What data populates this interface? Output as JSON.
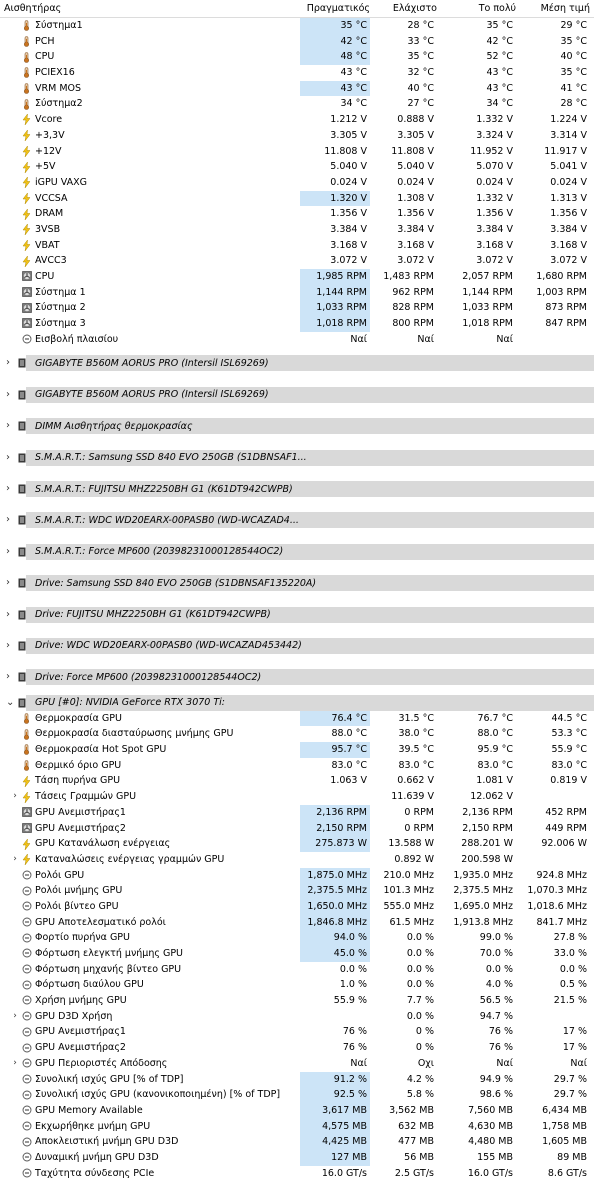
{
  "header": {
    "sensor": "Αισθητήρας",
    "current": "Πραγματικός",
    "min": "Ελάχιστο",
    "max": "Το πολύ",
    "avg": "Μέση τιμή"
  },
  "board_rows": [
    {
      "icon": "temp",
      "name": "Σύστημα1",
      "cur": "35 °C",
      "min": "28 °C",
      "max": "35 °C",
      "avg": "29 °C",
      "sel": true
    },
    {
      "icon": "temp",
      "name": "PCH",
      "cur": "42 °C",
      "min": "33 °C",
      "max": "42 °C",
      "avg": "35 °C",
      "sel": true
    },
    {
      "icon": "temp",
      "name": "CPU",
      "cur": "48 °C",
      "min": "35 °C",
      "max": "52 °C",
      "avg": "40 °C",
      "sel": true
    },
    {
      "icon": "temp",
      "name": "PCIEX16",
      "cur": "43 °C",
      "min": "32 °C",
      "max": "43 °C",
      "avg": "35 °C",
      "sel": false
    },
    {
      "icon": "temp",
      "name": "VRM MOS",
      "cur": "43 °C",
      "min": "40 °C",
      "max": "43 °C",
      "avg": "41 °C",
      "sel": true
    },
    {
      "icon": "temp",
      "name": "Σύστημα2",
      "cur": "34 °C",
      "min": "27 °C",
      "max": "34 °C",
      "avg": "28 °C",
      "sel": false
    },
    {
      "icon": "volt",
      "name": "Vcore",
      "cur": "1.212 V",
      "min": "0.888 V",
      "max": "1.332 V",
      "avg": "1.224 V",
      "sel": false
    },
    {
      "icon": "volt",
      "name": "+3,3V",
      "cur": "3.305 V",
      "min": "3.305 V",
      "max": "3.324 V",
      "avg": "3.314 V",
      "sel": false
    },
    {
      "icon": "volt",
      "name": "+12V",
      "cur": "11.808 V",
      "min": "11.808 V",
      "max": "11.952 V",
      "avg": "11.917 V",
      "sel": false
    },
    {
      "icon": "volt",
      "name": "+5V",
      "cur": "5.040 V",
      "min": "5.040 V",
      "max": "5.070 V",
      "avg": "5.041 V",
      "sel": false
    },
    {
      "icon": "volt",
      "name": "iGPU VAXG",
      "cur": "0.024 V",
      "min": "0.024 V",
      "max": "0.024 V",
      "avg": "0.024 V",
      "sel": false
    },
    {
      "icon": "volt",
      "name": "VCCSA",
      "cur": "1.320 V",
      "min": "1.308 V",
      "max": "1.332 V",
      "avg": "1.313 V",
      "sel": true
    },
    {
      "icon": "volt",
      "name": "DRAM",
      "cur": "1.356 V",
      "min": "1.356 V",
      "max": "1.356 V",
      "avg": "1.356 V",
      "sel": false
    },
    {
      "icon": "volt",
      "name": "3VSB",
      "cur": "3.384 V",
      "min": "3.384 V",
      "max": "3.384 V",
      "avg": "3.384 V",
      "sel": false
    },
    {
      "icon": "volt",
      "name": "VBAT",
      "cur": "3.168 V",
      "min": "3.168 V",
      "max": "3.168 V",
      "avg": "3.168 V",
      "sel": false
    },
    {
      "icon": "volt",
      "name": "AVCC3",
      "cur": "3.072 V",
      "min": "3.072 V",
      "max": "3.072 V",
      "avg": "3.072 V",
      "sel": false
    },
    {
      "icon": "fan",
      "name": "CPU",
      "cur": "1,985 RPM",
      "min": "1,483 RPM",
      "max": "2,057 RPM",
      "avg": "1,680 RPM",
      "sel": true
    },
    {
      "icon": "fan",
      "name": "Σύστημα 1",
      "cur": "1,144 RPM",
      "min": "962 RPM",
      "max": "1,144 RPM",
      "avg": "1,003 RPM",
      "sel": true
    },
    {
      "icon": "fan",
      "name": "Σύστημα 2",
      "cur": "1,033 RPM",
      "min": "828 RPM",
      "max": "1,033 RPM",
      "avg": "873 RPM",
      "sel": true
    },
    {
      "icon": "fan",
      "name": "Σύστημα 3",
      "cur": "1,018 RPM",
      "min": "800 RPM",
      "max": "1,018 RPM",
      "avg": "847 RPM",
      "sel": true
    },
    {
      "icon": "circle",
      "name": "Εισβολή πλαισίου",
      "cur": "Ναί",
      "min": "Ναί",
      "max": "Ναί",
      "avg": "",
      "sel": false
    }
  ],
  "groups": [
    "GIGABYTE B560M AORUS PRO (Intersil ISL69269)",
    "GIGABYTE B560M AORUS PRO (Intersil ISL69269)",
    "DIMM Αισθητήρας θερμοκρασίας",
    "S.M.A.R.T.: Samsung SSD 840 EVO 250GB (S1DBNSAF1...",
    "S.M.A.R.T.: FUJITSU MHZ2250BH G1 (K61DT942CWPB)",
    "S.M.A.R.T.: WDC WD20EARX-00PASB0 (WD-WCAZAD4...",
    "S.M.A.R.T.: Force MP600 (20398231000128544OC2)",
    "Drive: Samsung SSD 840 EVO 250GB (S1DBNSAF135220A)",
    "Drive: FUJITSU MHZ2250BH G1 (K61DT942CWPB)",
    "Drive: WDC WD20EARX-00PASB0 (WD-WCAZAD453442)",
    "Drive: Force MP600 (20398231000128544OC2)"
  ],
  "gpu_group": "GPU [#0]: NVIDIA GeForce RTX 3070 Ti:",
  "gpu_rows": [
    {
      "icon": "temp",
      "name": "Θερμοκρασία GPU",
      "cur": "76.4 °C",
      "min": "31.5 °C",
      "max": "76.7 °C",
      "avg": "44.5 °C",
      "sel": true
    },
    {
      "icon": "temp",
      "name": "Θερμοκρασία διασταύρωσης μνήμης GPU",
      "cur": "88.0 °C",
      "min": "38.0 °C",
      "max": "88.0 °C",
      "avg": "53.3 °C",
      "sel": false
    },
    {
      "icon": "temp",
      "name": "Θερμοκρασία Hot Spot GPU",
      "cur": "95.7 °C",
      "min": "39.5 °C",
      "max": "95.9 °C",
      "avg": "55.9 °C",
      "sel": true
    },
    {
      "icon": "temp",
      "name": "Θερμικό όριο GPU",
      "cur": "83.0 °C",
      "min": "83.0 °C",
      "max": "83.0 °C",
      "avg": "83.0 °C",
      "sel": false
    },
    {
      "icon": "volt",
      "name": "Τάση πυρήνα GPU",
      "cur": "1.063 V",
      "min": "0.662 V",
      "max": "1.081 V",
      "avg": "0.819 V",
      "sel": false
    },
    {
      "icon": "volt",
      "name": "Τάσεις Γραμμών GPU",
      "cur": "",
      "min": "11.639 V",
      "max": "12.062 V",
      "avg": "",
      "sel": false,
      "expand": true
    },
    {
      "icon": "fan",
      "name": "GPU Ανεμιστήρας1",
      "cur": "2,136 RPM",
      "min": "0 RPM",
      "max": "2,136 RPM",
      "avg": "452 RPM",
      "sel": true
    },
    {
      "icon": "fan",
      "name": "GPU Ανεμιστήρας2",
      "cur": "2,150 RPM",
      "min": "0 RPM",
      "max": "2,150 RPM",
      "avg": "449 RPM",
      "sel": true
    },
    {
      "icon": "volt",
      "name": "GPU Κατανάλωση ενέργειας",
      "cur": "275.873 W",
      "min": "13.588 W",
      "max": "288.201 W",
      "avg": "92.006 W",
      "sel": true
    },
    {
      "icon": "volt",
      "name": "Καταναλώσεις ενέργειας γραμμών GPU",
      "cur": "",
      "min": "0.892 W",
      "max": "200.598 W",
      "avg": "",
      "sel": false,
      "expand": true
    },
    {
      "icon": "circle",
      "name": "Ρολόι GPU",
      "cur": "1,875.0 MHz",
      "min": "210.0 MHz",
      "max": "1,935.0 MHz",
      "avg": "924.8 MHz",
      "sel": true
    },
    {
      "icon": "circle",
      "name": "Ρολόι μνήμης GPU",
      "cur": "2,375.5 MHz",
      "min": "101.3 MHz",
      "max": "2,375.5 MHz",
      "avg": "1,070.3 MHz",
      "sel": true
    },
    {
      "icon": "circle",
      "name": "Ρολόι βίντεο GPU",
      "cur": "1,650.0 MHz",
      "min": "555.0 MHz",
      "max": "1,695.0 MHz",
      "avg": "1,018.6 MHz",
      "sel": true
    },
    {
      "icon": "circle",
      "name": "GPU Αποτελεσματικό ρολόι",
      "cur": "1,846.8 MHz",
      "min": "61.5 MHz",
      "max": "1,913.8 MHz",
      "avg": "841.7 MHz",
      "sel": true
    },
    {
      "icon": "circle",
      "name": "Φορτίο πυρήνα GPU",
      "cur": "94.0 %",
      "min": "0.0 %",
      "max": "99.0 %",
      "avg": "27.8 %",
      "sel": true
    },
    {
      "icon": "circle",
      "name": "Φόρτωση ελεγκτή μνήμης GPU",
      "cur": "45.0 %",
      "min": "0.0 %",
      "max": "70.0 %",
      "avg": "33.0 %",
      "sel": true
    },
    {
      "icon": "circle",
      "name": "Φόρτωση μηχανής βίντεο GPU",
      "cur": "0.0 %",
      "min": "0.0 %",
      "max": "0.0 %",
      "avg": "0.0 %",
      "sel": false
    },
    {
      "icon": "circle",
      "name": "Φόρτωση διαύλου GPU",
      "cur": "1.0 %",
      "min": "0.0 %",
      "max": "4.0 %",
      "avg": "0.5 %",
      "sel": false
    },
    {
      "icon": "circle",
      "name": "Χρήση μνήμης GPU",
      "cur": "55.9 %",
      "min": "7.7 %",
      "max": "56.5 %",
      "avg": "21.5 %",
      "sel": false
    },
    {
      "icon": "circle",
      "name": "GPU D3D Χρήση",
      "cur": "",
      "min": "0.0 %",
      "max": "94.7 %",
      "avg": "",
      "sel": false,
      "expand": true
    },
    {
      "icon": "circle",
      "name": "GPU Ανεμιστήρας1",
      "cur": "76 %",
      "min": "0 %",
      "max": "76 %",
      "avg": "17 %",
      "sel": false
    },
    {
      "icon": "circle",
      "name": "GPU Ανεμιστήρας2",
      "cur": "76 %",
      "min": "0 %",
      "max": "76 %",
      "avg": "17 %",
      "sel": false
    },
    {
      "icon": "circle",
      "name": "GPU Περιοριστές Απόδοσης",
      "cur": "Ναί",
      "min": "Οχι",
      "max": "Ναί",
      "avg": "Ναί",
      "sel": false,
      "expand": true
    },
    {
      "icon": "circle",
      "name": "Συνολική ισχύς GPU [% of TDP]",
      "cur": "91.2 %",
      "min": "4.2 %",
      "max": "94.9 %",
      "avg": "29.7 %",
      "sel": true
    },
    {
      "icon": "circle",
      "name": "Συνολική ισχύς GPU (κανονικοποιημένη) [% of TDP]",
      "cur": "92.5 %",
      "min": "5.8 %",
      "max": "98.6 %",
      "avg": "29.7 %",
      "sel": true
    },
    {
      "icon": "circle",
      "name": "GPU Memory Available",
      "cur": "3,617 MB",
      "min": "3,562 MB",
      "max": "7,560 MB",
      "avg": "6,434 MB",
      "sel": true
    },
    {
      "icon": "circle",
      "name": "Εκχωρήθηκε μνήμη GPU",
      "cur": "4,575 MB",
      "min": "632 MB",
      "max": "4,630 MB",
      "avg": "1,758 MB",
      "sel": true
    },
    {
      "icon": "circle",
      "name": "Αποκλειστική μνήμη GPU D3D",
      "cur": "4,425 MB",
      "min": "477 MB",
      "max": "4,480 MB",
      "avg": "1,605 MB",
      "sel": true
    },
    {
      "icon": "circle",
      "name": "Δυναμική μνήμη GPU D3D",
      "cur": "127 MB",
      "min": "56 MB",
      "max": "155 MB",
      "avg": "89 MB",
      "sel": true
    },
    {
      "icon": "circle",
      "name": "Ταχύτητα σύνδεσης PCIe",
      "cur": "16.0 GT/s",
      "min": "2.5 GT/s",
      "max": "16.0 GT/s",
      "avg": "8.6 GT/s",
      "sel": false
    }
  ],
  "colors": {
    "selected": "#cce4f7",
    "group_bar": "#d9d9d9",
    "thermo": "#c9731f",
    "bolt": "#f2c318"
  }
}
